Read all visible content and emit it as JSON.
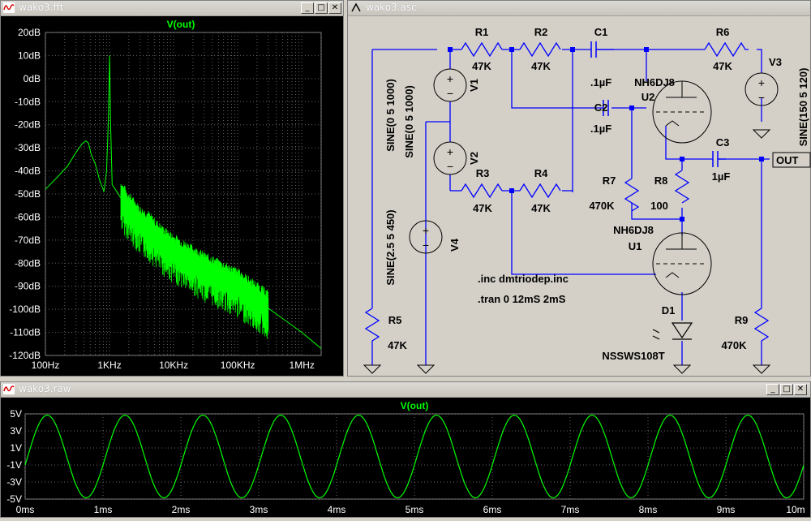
{
  "fft_window": {
    "title": "wako3.fft",
    "trace_label": "V(out)",
    "trace_color": "#00ff00",
    "y_ticks": [
      "20dB",
      "10dB",
      "0dB",
      "-10dB",
      "-20dB",
      "-30dB",
      "-40dB",
      "-50dB",
      "-60dB",
      "-70dB",
      "-80dB",
      "-90dB",
      "-100dB",
      "-110dB",
      "-120dB"
    ],
    "x_ticks": [
      "100Hz",
      "1KHz",
      "10KHz",
      "100KHz",
      "1MHz"
    ]
  },
  "schematic_window": {
    "title": "wako3.asc",
    "wire_color": "#0000ff",
    "components": {
      "r1_name": "R1",
      "r1_value": "47K",
      "r2_name": "R2",
      "r2_value": "47K",
      "r3_name": "R3",
      "r3_value": "47K",
      "r4_name": "R4",
      "r4_value": "47K",
      "r5_name": "R5",
      "r5_value": "47K",
      "r6_name": "R6",
      "r6_value": "47K",
      "r7_name": "R7",
      "r7_value": "470K",
      "r8_name": "R8",
      "r8_value": "100",
      "r9_name": "R9",
      "r9_value": "470K",
      "c1_name": "C1",
      "c1_value": ".1µF",
      "c2_name": "C2",
      "c2_value": ".1µF",
      "c3_name": "C3",
      "c3_value": "1µF",
      "v1_name": "V1",
      "v1_value": "SINE(0 5 1000)",
      "v2_name": "V2",
      "v2_value": "SINE(0 5 1000)",
      "v3_name": "V3",
      "v3_value": "SINE(150 5 120)",
      "v4_name": "V4",
      "v4_value": "SINE(2.5 5 450)",
      "u1_name": "U1",
      "u1_model": "NH6DJ8",
      "u2_name": "U2",
      "u2_model": "NH6DJ8",
      "d1_name": "D1",
      "d1_model": "NSSWS108T",
      "out_label": "OUT"
    },
    "directives": [
      ".inc dmtriodep.inc",
      ".tran 0 12mS 2mS"
    ]
  },
  "raw_window": {
    "title": "wako3.raw",
    "trace_label": "V(out)",
    "y_ticks": [
      "5V",
      "3V",
      "1V",
      "-1V",
      "-3V",
      "-5V"
    ],
    "x_ticks": [
      "0ms",
      "1ms",
      "2ms",
      "3ms",
      "4ms",
      "5ms",
      "6ms",
      "7ms",
      "8ms",
      "9ms",
      "10m"
    ]
  },
  "chart_data": [
    {
      "type": "line",
      "title": "V(out)",
      "x_scale": "log",
      "x_range_hz": [
        100,
        2000000
      ],
      "ylim": [
        -120,
        20
      ],
      "y_unit": "dB",
      "grid": true,
      "series": [
        {
          "name": "V(out)",
          "x": [
            100,
            150,
            220,
            300,
            380,
            430,
            470,
            520,
            600,
            700,
            820,
            900,
            960,
            1000,
            1040,
            1100,
            1300,
            1600,
            2000,
            2500,
            3000,
            4000,
            5000,
            7000,
            10000,
            15000,
            20000,
            30000,
            50000,
            100000,
            200000,
            500000,
            1000000,
            2000000
          ],
          "y": [
            -48,
            -43,
            -38,
            -32,
            -28,
            -27,
            -28,
            -33,
            -37,
            -44,
            -49,
            -40,
            -18,
            10,
            -20,
            -46,
            -49,
            -53,
            -57,
            -60,
            -63,
            -65,
            -68,
            -72,
            -75,
            -78,
            -80,
            -83,
            -86,
            -90,
            -96,
            -104,
            -110,
            -117
          ]
        }
      ]
    },
    {
      "type": "line",
      "title": "V(out)",
      "xlabel": "",
      "xlim": [
        0,
        10
      ],
      "ylim": [
        -5,
        5
      ],
      "x_unit": "ms",
      "grid": true,
      "series": [
        {
          "name": "V(out)",
          "x": [
            0,
            0.25,
            0.5,
            0.75,
            1.0,
            1.25,
            1.5,
            1.75,
            2.0,
            2.25,
            2.5,
            2.75,
            3.0,
            3.25,
            3.5,
            3.75,
            4.0,
            4.25,
            4.5,
            4.75,
            5.0,
            5.25,
            5.5,
            5.75,
            6.0,
            6.25,
            6.5,
            6.75,
            7.0,
            7.25,
            7.5,
            7.75,
            8.0,
            8.25,
            8.5,
            8.75,
            9.0,
            9.25,
            9.5,
            9.75,
            10.0
          ],
          "y": [
            -1,
            4.7,
            1.0,
            -4.7,
            -1,
            4.7,
            1.0,
            -4.7,
            -1,
            4.7,
            1.0,
            -4.7,
            -1,
            4.7,
            1.0,
            -4.7,
            -1,
            4.7,
            1.0,
            -4.7,
            -1,
            4.7,
            1.0,
            -4.7,
            -1,
            4.7,
            1.0,
            -4.7,
            -1,
            4.7,
            1.0,
            -4.7,
            -1,
            4.7,
            1.0,
            -4.7,
            -1,
            4.7,
            1.0,
            -4.7,
            -1
          ]
        }
      ]
    }
  ]
}
